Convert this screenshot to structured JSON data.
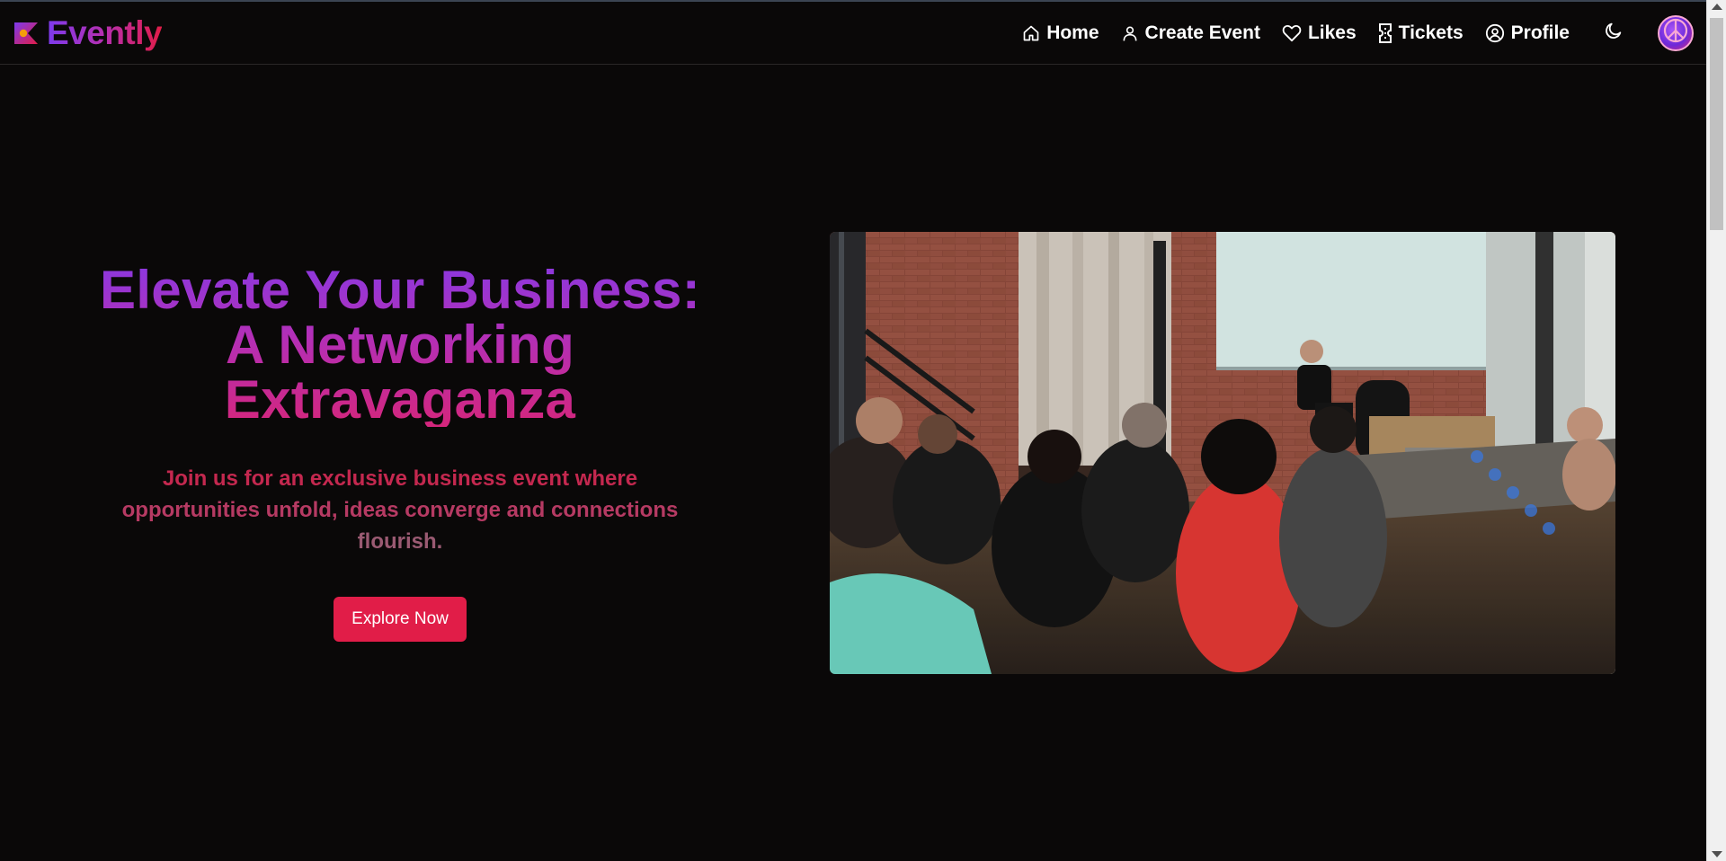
{
  "brand": {
    "name": "Evently"
  },
  "nav": {
    "items": [
      {
        "label": "Home",
        "icon": "home-icon"
      },
      {
        "label": "Create Event",
        "icon": "user-icon"
      },
      {
        "label": "Likes",
        "icon": "heart-icon"
      },
      {
        "label": "Tickets",
        "icon": "ticket-icon"
      },
      {
        "label": "Profile",
        "icon": "user-circle-icon"
      }
    ],
    "theme_toggle_icon": "moon-icon",
    "avatar_icon": "peace-sign-icon"
  },
  "hero": {
    "title_line1": "Elevate Your Business:",
    "title_line2": "A Networking",
    "title_line3": "Extravaganza",
    "subtitle_line1": "Join us for an exclusive business event where",
    "subtitle_line2": "opportunities unfold, ideas converge and connections",
    "subtitle_line3": "flourish.",
    "cta_label": "Explore Now"
  },
  "colors": {
    "background": "#0a0808",
    "accent": "#e11d48",
    "brand_gradient_start": "#7c3aed",
    "brand_gradient_end": "#e11d48"
  }
}
